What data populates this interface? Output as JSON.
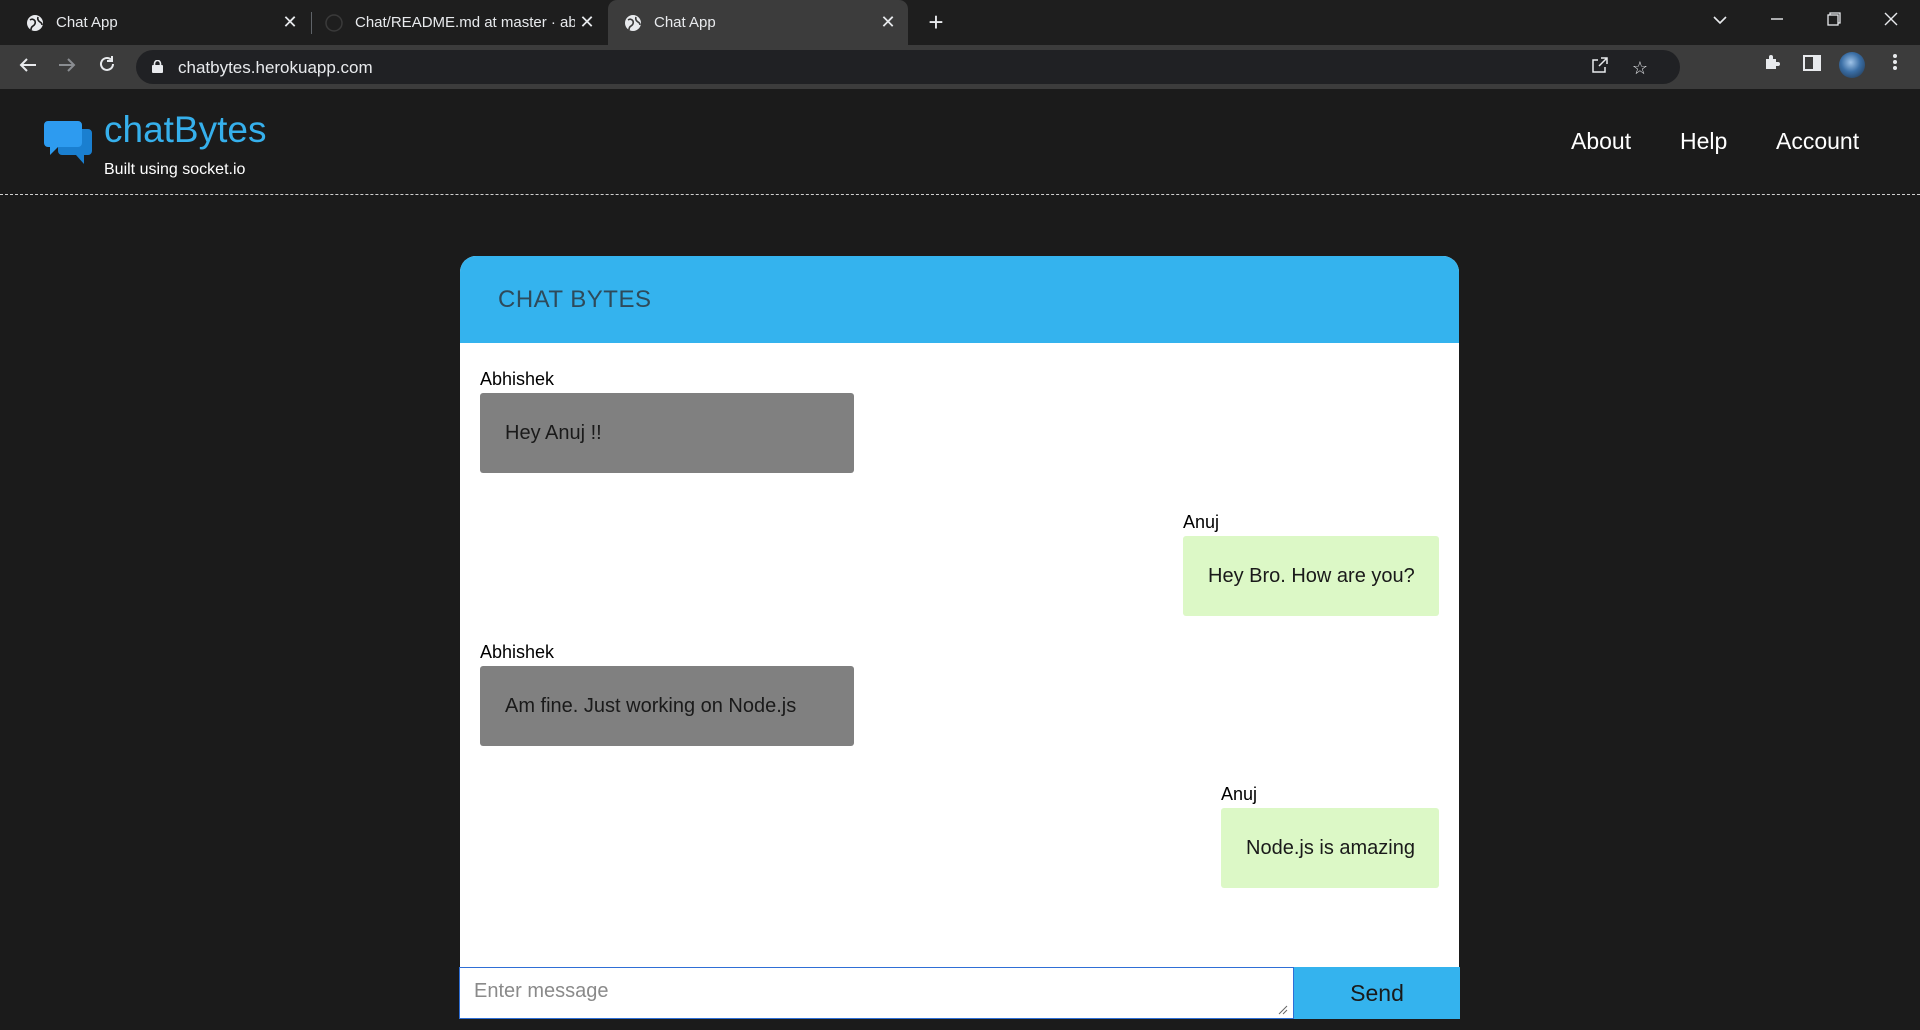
{
  "browser": {
    "tabs": [
      {
        "title": "Chat App",
        "icon": "globe-icon",
        "active": false
      },
      {
        "title": "Chat/README.md at master · abh",
        "icon": "github-icon",
        "active": false
      },
      {
        "title": "Chat App",
        "icon": "globe-icon",
        "active": true
      }
    ],
    "address": "chatbytes.herokuapp.com"
  },
  "site": {
    "brand": "chatBytes",
    "tagline": "Built using socket.io",
    "nav": [
      "About",
      "Help",
      "Account"
    ],
    "accent": "#34b3ee"
  },
  "chat": {
    "title": "CHAT BYTES",
    "messages": [
      {
        "sender": "Abhishek",
        "text": "Hey Anuj !!",
        "direction": "incoming"
      },
      {
        "sender": "Anuj",
        "text": "Hey Bro. How are you?",
        "direction": "outgoing"
      },
      {
        "sender": "Abhishek",
        "text": "Am fine. Just working on Node.js",
        "direction": "incoming"
      },
      {
        "sender": "Anuj",
        "text": "Node.js is amazing",
        "direction": "outgoing"
      }
    ],
    "input_placeholder": "Enter message",
    "send_label": "Send"
  }
}
